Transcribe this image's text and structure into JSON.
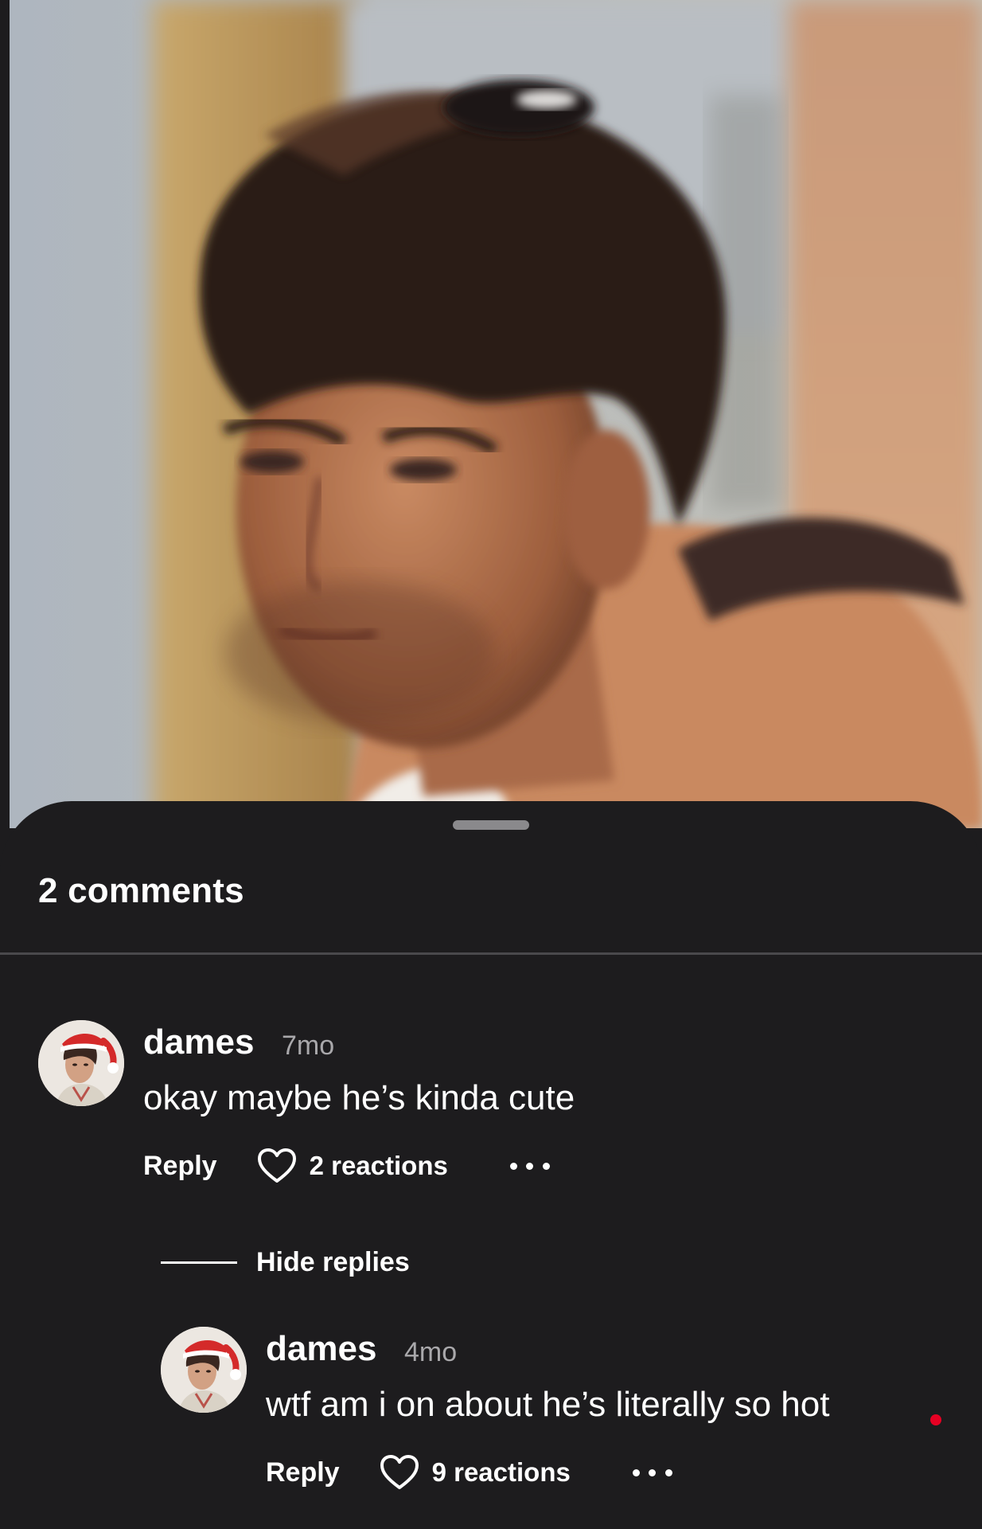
{
  "sheet": {
    "comments_count_label": "2 comments"
  },
  "comments": [
    {
      "author": "dames",
      "time": "7mo",
      "text": "okay maybe he’s kinda cute",
      "reply_label": "Reply",
      "reactions_label": "2 reactions"
    }
  ],
  "replies_toggle": {
    "label": "Hide replies"
  },
  "replies": [
    {
      "author": "dames",
      "time": "4mo",
      "text": "wtf am i on about he’s literally so hot",
      "reply_label": "Reply",
      "reactions_label": "9 reactions"
    }
  ],
  "icons": {
    "heart": "heart-outline-icon",
    "more": "more-horizontal-icon"
  },
  "colors": {
    "sheet_background": "#1d1c1e",
    "text_primary": "#ffffff",
    "text_secondary": "#a9a8ab",
    "notification_dot": "#e60023"
  }
}
